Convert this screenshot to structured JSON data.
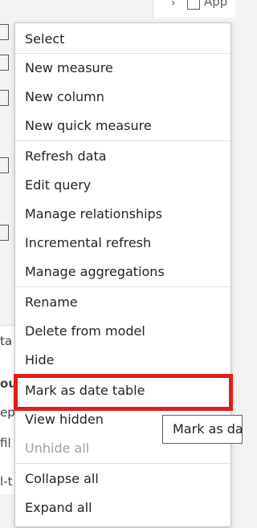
{
  "background": {
    "top_partial_text": "App",
    "left_fragments": [
      "ta",
      "ou",
      "ep",
      "fil",
      "l-t"
    ]
  },
  "menu": {
    "items": [
      {
        "label": "Select"
      },
      {
        "label": "New measure"
      },
      {
        "label": "New column"
      },
      {
        "label": "New quick measure"
      },
      {
        "label": "Refresh data"
      },
      {
        "label": "Edit query"
      },
      {
        "label": "Manage relationships"
      },
      {
        "label": "Incremental refresh"
      },
      {
        "label": "Manage aggregations"
      },
      {
        "label": "Rename"
      },
      {
        "label": "Delete from model"
      },
      {
        "label": "Hide"
      },
      {
        "label": "Mark as date table"
      },
      {
        "label": "View hidden"
      },
      {
        "label": "Unhide all",
        "disabled": true
      },
      {
        "label": "Collapse all"
      },
      {
        "label": "Expand all"
      }
    ]
  },
  "tooltip": {
    "text": "Mark as date table"
  },
  "colors": {
    "highlight": "#e21b1b",
    "disabled_text": "#a19f9d"
  }
}
